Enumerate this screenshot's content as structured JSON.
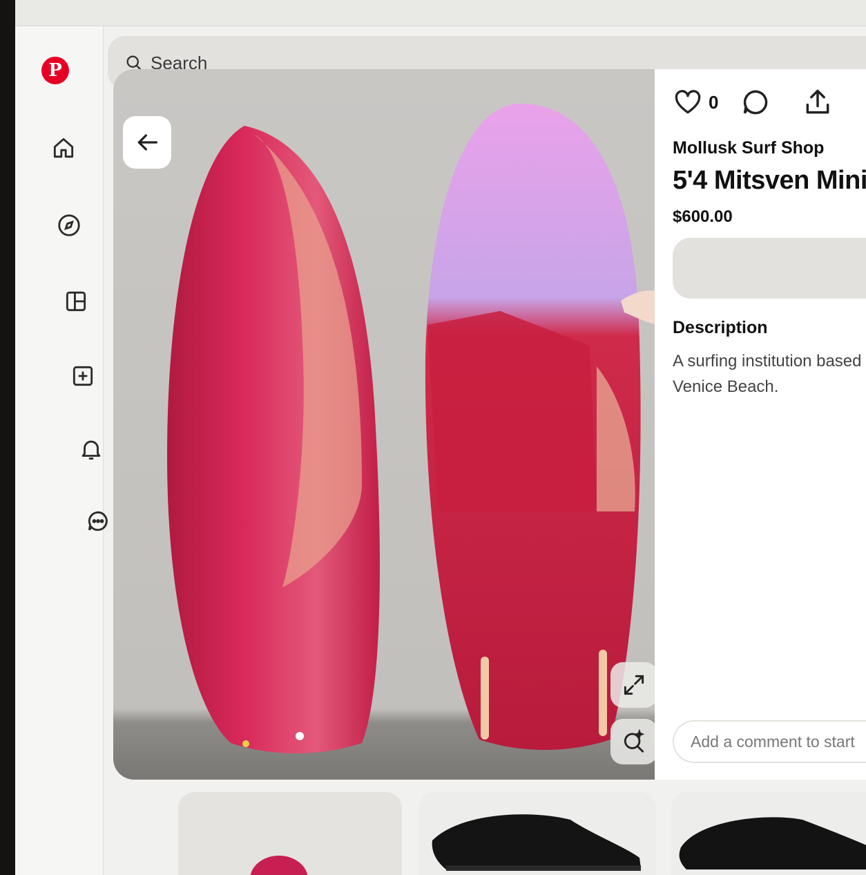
{
  "app": {
    "logo_glyph": "P",
    "brand_color": "#e60023"
  },
  "nav": {
    "items": [
      {
        "name": "home",
        "icon": "home-icon"
      },
      {
        "name": "explore",
        "icon": "compass-icon"
      },
      {
        "name": "dashboard",
        "icon": "dashboard-icon"
      },
      {
        "name": "create",
        "icon": "plus-square-icon"
      },
      {
        "name": "notifications",
        "icon": "bell-icon"
      },
      {
        "name": "messages",
        "icon": "chat-icon"
      }
    ]
  },
  "search": {
    "placeholder": "Search"
  },
  "pin": {
    "like_count": "0",
    "store": "Mollusk Surf Shop",
    "title": "5'4 Mitsven Mini",
    "price": "$600.00",
    "description_heading": "Description",
    "description": "A surfing institution based in Venice Beach.",
    "comment_placeholder": "Add a comment to start",
    "image_colors": {
      "board": "#d3234f",
      "board_dark": "#a9183b",
      "sky": "#c8a4e8",
      "wall": "#c5c3bf"
    }
  },
  "related_pins": [
    {
      "name": "surfboard-pin"
    },
    {
      "name": "shoe-pin"
    },
    {
      "name": "shoe-pin-2"
    }
  ]
}
